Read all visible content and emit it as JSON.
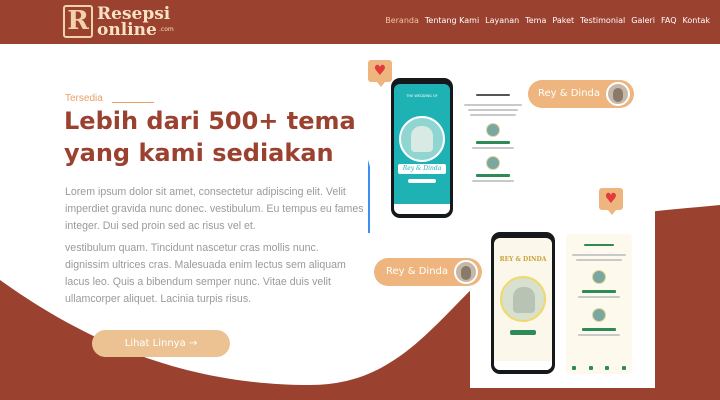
{
  "brand": {
    "logo_mark": "R",
    "logo_top": "Resepsi",
    "logo_bottom": "online",
    "logo_suffix": ".com",
    "primary_color": "#9b4130",
    "accent_color": "#edc293"
  },
  "nav": {
    "items": [
      {
        "label": "Beranda",
        "active": true
      },
      {
        "label": "Tentang Kami"
      },
      {
        "label": "Layanan"
      },
      {
        "label": "Tema"
      },
      {
        "label": "Paket"
      },
      {
        "label": "Testimonial"
      },
      {
        "label": "Galeri"
      },
      {
        "label": "FAQ"
      },
      {
        "label": "Kontak"
      }
    ]
  },
  "hero": {
    "eyebrow": "Tersedia",
    "title": "Lebih dari 500+ tema yang kami sediakan",
    "paragraph_1": "Lorem ipsum dolor sit amet, consectetur adipiscing elit. Velit imperdiet gravida nunc donec. vestibulum. Eu tempus eu fames integer. Dui sed proin sed ac risus vel et.",
    "paragraph_2": "vestibulum quam. Tincidunt nascetur cras mollis nunc. dignissim ultrices cras. Malesuada enim lectus sem aliquam lacus leo. Quis a bibendum semper nunc. Vitae duis velit ullamcorper aliquet. Lacinia turpis risus.",
    "cta_label": "Lihat Linnya →"
  },
  "mockups": {
    "couple_label_1": "Rey & Dinda",
    "couple_label_2": "Rey & Dinda",
    "phone_1_names": "Rey & Dinda",
    "phone_2_title": "REY & DINDA",
    "heart_icon": "♥"
  }
}
